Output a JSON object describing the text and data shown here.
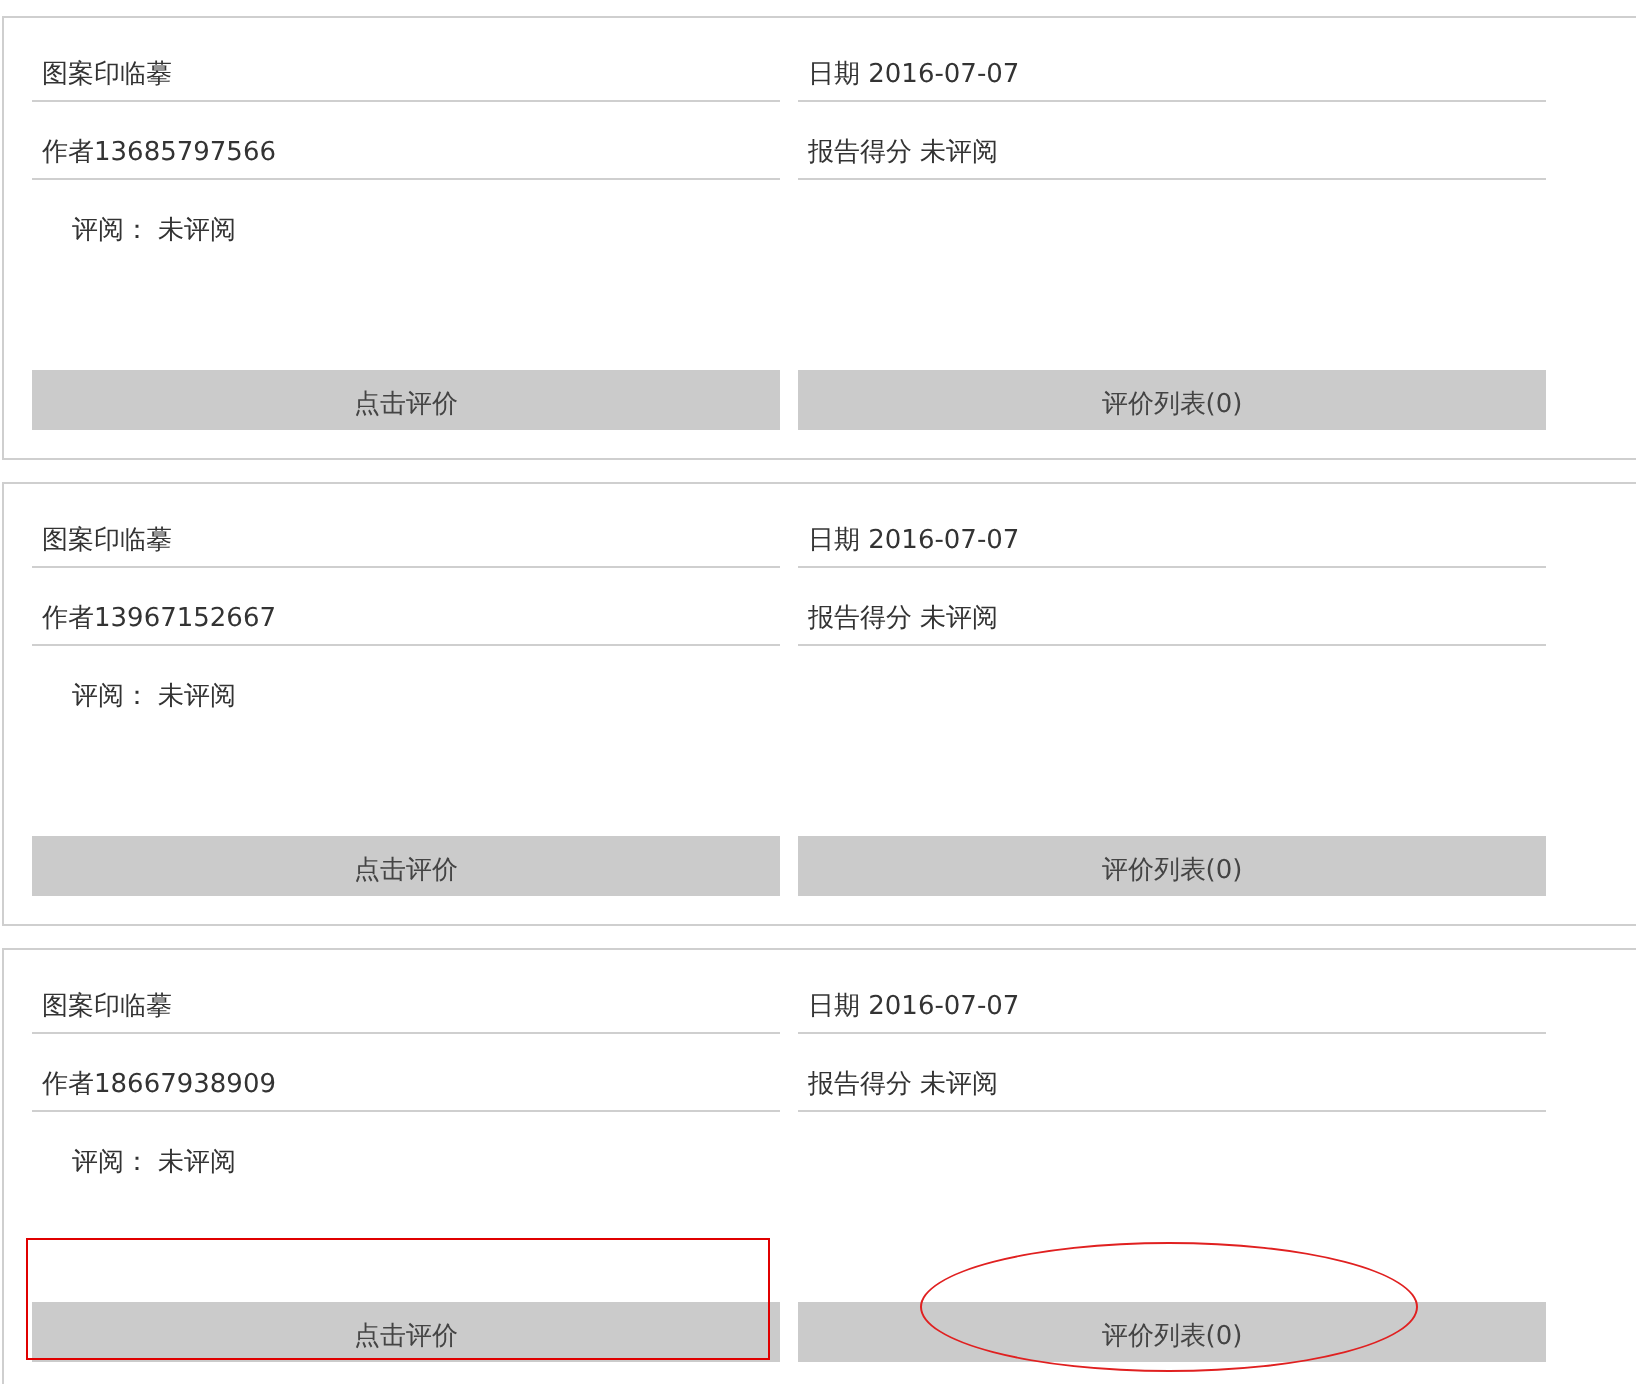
{
  "cards": [
    {
      "title": "图案印临摹",
      "date": "日期 2016-07-07",
      "author": "作者13685797566",
      "score": "报告得分 未评阅",
      "review": "评阅： 未评阅",
      "buttons": [
        {
          "label": "点击评价",
          "kind": "plain"
        },
        {
          "label": "评价列表(0)",
          "kind": "plain"
        }
      ]
    },
    {
      "title": "图案印临摹",
      "date": "日期 2016-07-07",
      "author": "作者13967152667",
      "score": "报告得分 未评阅",
      "review": "评阅： 未评阅",
      "buttons": [
        {
          "label": "点击评价",
          "kind": "plain"
        },
        {
          "label": "评价列表(0)",
          "kind": "plain"
        }
      ]
    },
    {
      "title": "图案印临摹",
      "date": "日期 2016-07-07",
      "author": "作者18667938909",
      "score": "报告得分 未评阅",
      "review": "评阅： 未评阅",
      "buttons": [
        {
          "label": "点击评价",
          "kind": "boxed"
        },
        {
          "label": "评价列表(0)",
          "kind": "circled"
        }
      ]
    }
  ]
}
